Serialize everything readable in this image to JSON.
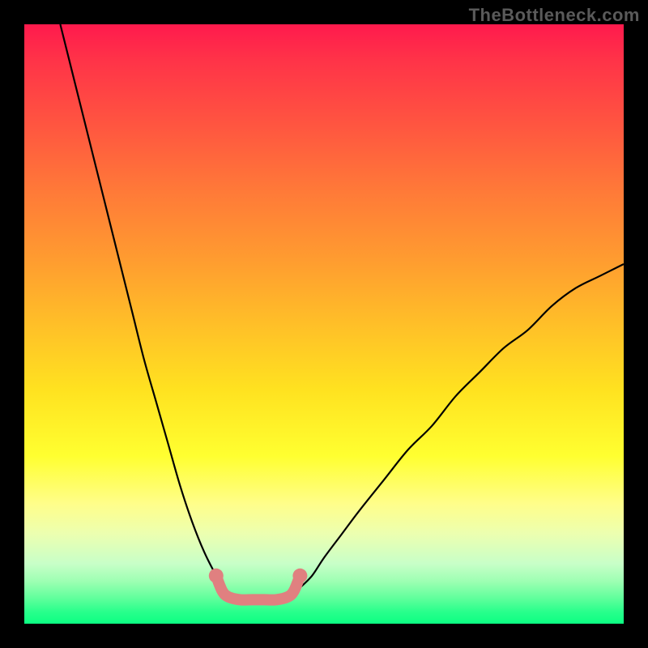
{
  "watermark": "TheBottleneck.com",
  "chart_data": {
    "type": "line",
    "title": "",
    "xlabel": "",
    "ylabel": "",
    "xlim": [
      0,
      100
    ],
    "ylim": [
      0,
      100
    ],
    "series": [
      {
        "name": "black-curve-left",
        "x": [
          6,
          8,
          10,
          12,
          14,
          16,
          18,
          20,
          22,
          24,
          26,
          28,
          30,
          32,
          33
        ],
        "y": [
          100,
          92,
          84,
          76,
          68,
          60,
          52,
          44,
          37,
          30,
          23,
          17,
          12,
          8,
          6
        ]
      },
      {
        "name": "black-curve-right",
        "x": [
          46,
          48,
          50,
          53,
          56,
          60,
          64,
          68,
          72,
          76,
          80,
          84,
          88,
          92,
          96,
          100
        ],
        "y": [
          6,
          8,
          11,
          15,
          19,
          24,
          29,
          33,
          38,
          42,
          46,
          49,
          53,
          56,
          58,
          60
        ]
      },
      {
        "name": "pink-segment",
        "x": [
          32,
          33,
          34,
          36,
          38,
          40,
          42,
          44,
          45,
          46
        ],
        "y": [
          8,
          5.5,
          4.5,
          4,
          4,
          4,
          4,
          4.5,
          5.5,
          8
        ]
      }
    ],
    "annotations": []
  }
}
